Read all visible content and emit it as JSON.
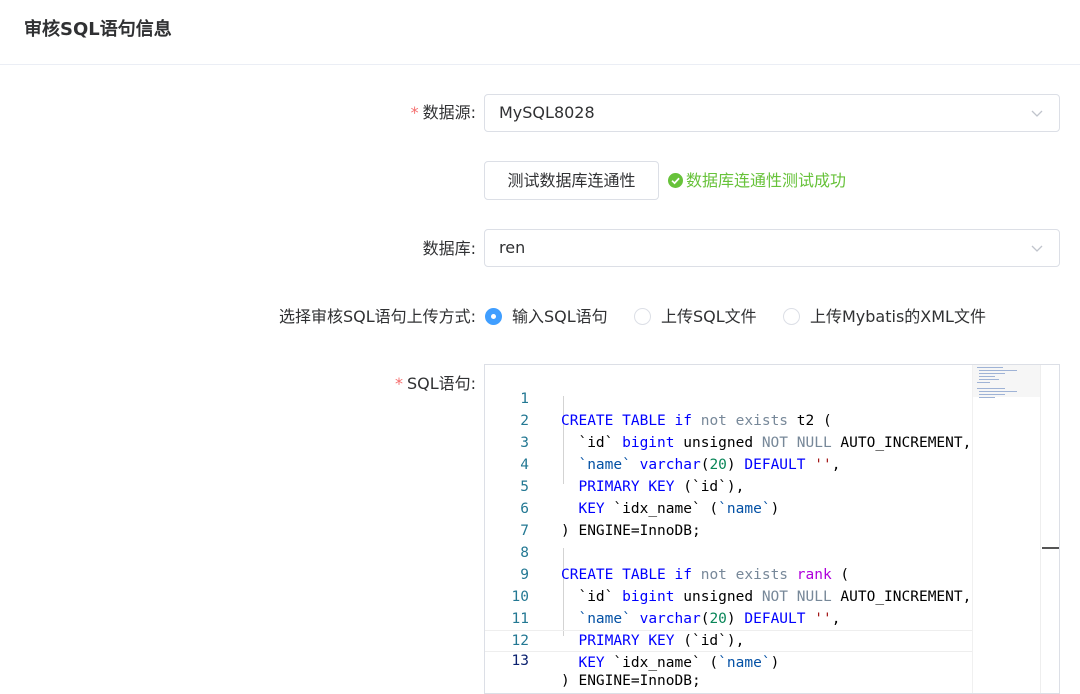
{
  "page": {
    "title": "审核SQL语句信息"
  },
  "form": {
    "datasource": {
      "required_mark": "*",
      "label": "数据源:",
      "value": "MySQL8028"
    },
    "test_button": {
      "label": "测试数据库连通性"
    },
    "test_result": {
      "text": "数据库连通性测试成功",
      "icon": "check-circle-icon",
      "color": "#67c23a"
    },
    "database": {
      "label": "数据库:",
      "value": "ren"
    },
    "upload_mode": {
      "label": "选择审核SQL语句上传方式:",
      "options": [
        {
          "label": "输入SQL语句",
          "checked": true
        },
        {
          "label": "上传SQL文件",
          "checked": false
        },
        {
          "label": "上传Mybatis的XML文件",
          "checked": false
        }
      ]
    },
    "sql": {
      "required_mark": "*",
      "label": "SQL语句:"
    }
  },
  "editor": {
    "current_line": 13,
    "lines": [
      "CREATE TABLE if not exists t2 (",
      "  `id` bigint unsigned NOT NULL AUTO_INCREMENT,",
      "  `name` varchar(20) DEFAULT '',",
      "  PRIMARY KEY (`id`),",
      "  KEY `idx_name` (`name`)",
      ") ENGINE=InnoDB;",
      "",
      "CREATE TABLE if not exists rank (",
      "  `id` bigint unsigned NOT NULL AUTO_INCREMENT,",
      "  `name` varchar(20) DEFAULT '',",
      "  PRIMARY KEY (`id`),",
      "  KEY `idx_name` (`name`)",
      ") ENGINE=InnoDB;"
    ]
  },
  "colors": {
    "primary": "#409eff",
    "required": "#f56c6c",
    "success": "#67c23a",
    "keyword": "#0000ff",
    "line_number": "#237893"
  }
}
